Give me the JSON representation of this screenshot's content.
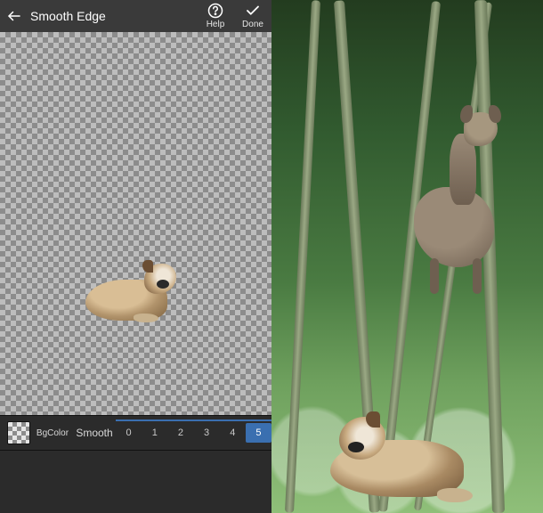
{
  "header": {
    "title": "Smooth Edge",
    "help_label": "Help",
    "done_label": "Done",
    "back_icon": "arrow-left",
    "help_icon": "question-circle",
    "done_icon": "check"
  },
  "slider": {
    "bgcolor_label": "BgColor",
    "control_label": "Smooth",
    "options": [
      "0",
      "1",
      "2",
      "3",
      "4",
      "5"
    ],
    "selected_value": "5",
    "selected_index": 5
  },
  "canvas": {
    "subject": "dog-cutout",
    "background": "transparent-checker"
  },
  "composite_preview": {
    "background_scene": "forest-with-deer",
    "foreground_subject": "dog-cutout"
  },
  "colors": {
    "header_bg": "#3a3a3a",
    "panel_bg": "#2b2b2b",
    "accent": "#3a6fb0",
    "text": "#e6e6e6"
  }
}
